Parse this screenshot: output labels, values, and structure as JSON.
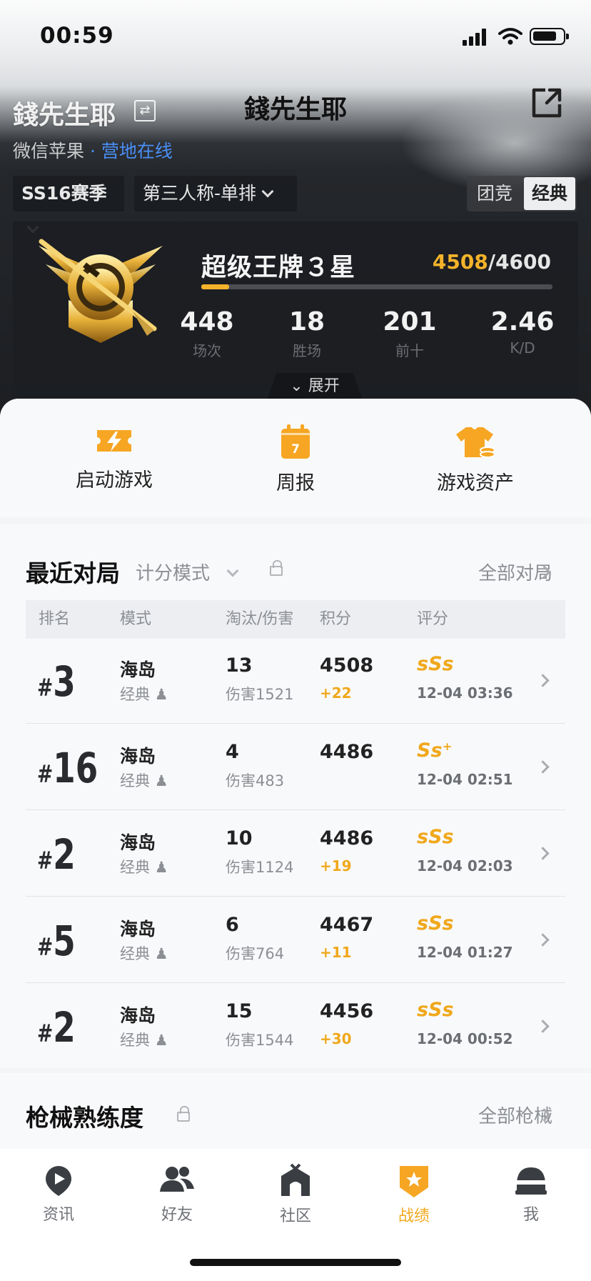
{
  "status_bar": {
    "time": "00:59"
  },
  "header": {
    "title": "錢先生耶",
    "ghost_name": "錢先生耶",
    "platform": "微信苹果",
    "separator": " · ",
    "online_status": "营地在线"
  },
  "filters": {
    "season": "SS16赛季",
    "mode": "第三人称-单排",
    "segment": [
      "团竞",
      "经典"
    ],
    "active_segment": "经典"
  },
  "rank": {
    "tier": "超级王牌３星",
    "points_current": "4508",
    "points_sep": "/",
    "points_target": "4600",
    "progress": 0.08,
    "stats": [
      {
        "value": "448",
        "label": "场次"
      },
      {
        "value": "18",
        "label": "胜场"
      },
      {
        "value": "201",
        "label": "前十"
      },
      {
        "value": "2.46",
        "label": "K/D"
      }
    ],
    "expand_label": "展开"
  },
  "quick_actions": [
    {
      "label": "启动游戏",
      "icon": "lightning-ticket-icon"
    },
    {
      "label": "周报",
      "icon": "calendar-icon",
      "badge": "7"
    },
    {
      "label": "游戏资产",
      "icon": "shirt-coins-icon"
    }
  ],
  "recent": {
    "title": "最近对局",
    "mode_label": "计分模式",
    "all_label": "全部对局",
    "headers": [
      "排名",
      "模式",
      "淘汰/伤害",
      "积分",
      "评分"
    ],
    "rows": [
      {
        "hash": "#",
        "rank": "3",
        "map": "海岛",
        "mode": "经典",
        "kills": "13",
        "damage": "伤害1521",
        "score": "4508",
        "delta": "+22",
        "grade": "sSs",
        "date": "12-04 03:36"
      },
      {
        "hash": "#",
        "rank": "16",
        "map": "海岛",
        "mode": "经典",
        "kills": "4",
        "damage": "伤害483",
        "score": "4486",
        "delta": "",
        "grade": "Ss⁺",
        "date": "12-04 02:51"
      },
      {
        "hash": "#",
        "rank": "2",
        "map": "海岛",
        "mode": "经典",
        "kills": "10",
        "damage": "伤害1124",
        "score": "4486",
        "delta": "+19",
        "grade": "sSs",
        "date": "12-04 02:03"
      },
      {
        "hash": "#",
        "rank": "5",
        "map": "海岛",
        "mode": "经典",
        "kills": "6",
        "damage": "伤害764",
        "score": "4467",
        "delta": "+11",
        "grade": "sSs",
        "date": "12-04 01:27"
      },
      {
        "hash": "#",
        "rank": "2",
        "map": "海岛",
        "mode": "经典",
        "kills": "15",
        "damage": "伤害1544",
        "score": "4456",
        "delta": "+30",
        "grade": "sSs",
        "date": "12-04 00:52"
      }
    ]
  },
  "guns": {
    "title": "枪械熟练度",
    "all_label": "全部枪械"
  },
  "tabs": [
    {
      "label": "资讯",
      "icon": "play-pin-icon"
    },
    {
      "label": "好友",
      "icon": "friends-icon"
    },
    {
      "label": "社区",
      "icon": "community-house-icon"
    },
    {
      "label": "战绩",
      "icon": "record-badge-icon",
      "active": true
    },
    {
      "label": "我",
      "icon": "helmet-icon"
    }
  ],
  "colors": {
    "accent": "#f0a81c",
    "online": "#4a8ff7",
    "dark_card": "#1c1e22"
  }
}
